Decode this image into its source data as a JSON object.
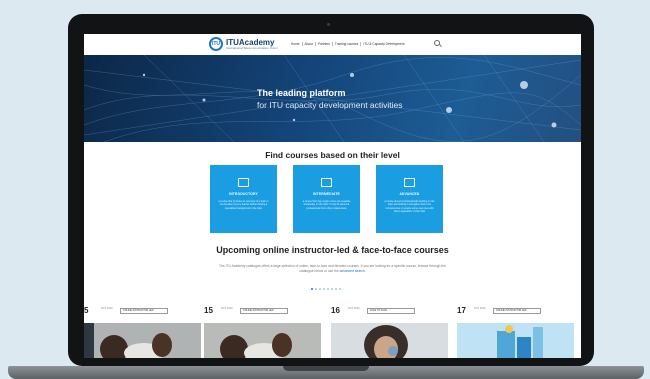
{
  "site": {
    "logo_title": "ITUAcademy",
    "logo_sub": "International Telecommunication Union",
    "menu": [
      "Home",
      "About",
      "Partners",
      "Training courses",
      "ITU & Capacity Development"
    ]
  },
  "hero": {
    "title": "The leading platform",
    "subtitle": "for ITU capacity development activities"
  },
  "levels": {
    "title": "Find courses based on their level",
    "cards": [
      {
        "label": "INTRODUCTORY",
        "desc": "a course that provides an overview of a topic or can be taken by any learner without having a specialized background in the topic"
      },
      {
        "label": "INTERMEDIATE",
        "desc": "a course that may require some pre-requisite knowledge on the topic. It may be aimed at professionals from other related areas"
      },
      {
        "label": "ADVANCED",
        "desc": "a course aimed at professionals working on the topic and looking to strengthen their core competencies or acquire some new ones with direct application to their field"
      }
    ]
  },
  "upcoming": {
    "title": "Upcoming online instructor-led & face-to-face courses",
    "intro": "The ITU Academy catalogue offers a large selection of online, face-to-face and blended courses. If you are looking for a specific course, browse through the catalogue below or use the",
    "intro_link": "advanced search.",
    "courses": [
      {
        "day": "5",
        "month": "OCT 2020",
        "tag": "ONLINE INSTRUCTOR LED"
      },
      {
        "day": "15",
        "month": "OCT 2020",
        "tag": "ONLINE INSTRUCTOR LED"
      },
      {
        "day": "16",
        "month": "OCT 2020",
        "tag": "FACE TO FACE"
      },
      {
        "day": "17",
        "month": "OCT 2020",
        "tag": "ONLINE INSTRUCTOR LED"
      }
    ]
  },
  "colors": {
    "accent": "#1b9de2",
    "brand": "#173f6b"
  }
}
